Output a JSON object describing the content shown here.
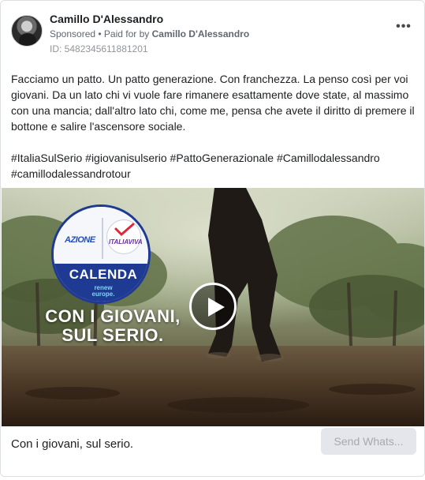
{
  "post": {
    "author_name": "Camillo D'Alessandro",
    "sponsored_label": "Sponsored",
    "separator": " • ",
    "paid_for_prefix": "Paid for by ",
    "paid_for_name": "Camillo D'Alessandro",
    "ad_id": "ID: 5482345611881201",
    "more_label": "•••",
    "body_text": "Facciamo un patto. Un patto generazione. Con franchezza. La penso così per voi giovani. Da un lato chi vi vuole fare rimanere esattamente dove state, al massimo con una mancia; dall'altro lato chi, come me, pensa che avete il diritto di premere il bottone e salire l'ascensore sociale.",
    "hashtags": "#ItaliaSulSerio #igiovanisulserio #PattoGenerazionale #Camillodalessandro #camillodalessandrotour"
  },
  "video": {
    "logo_azione": "AZIONE",
    "logo_italiaviva": "ITALIAVIVA",
    "logo_calenda": "CALENDA",
    "logo_renew_line1": "renew",
    "logo_renew_line2": "europe.",
    "headline_line1": "CON I GIOVANI,",
    "headline_line2": "SUL SERIO."
  },
  "footer": {
    "caption": "Con i giovani, sul serio.",
    "cta_label": "Send Whats..."
  },
  "colors": {
    "calenda_blue": "#1f3a93",
    "cta_bg": "#e4e6eb",
    "cta_text": "#a7a9ad"
  }
}
